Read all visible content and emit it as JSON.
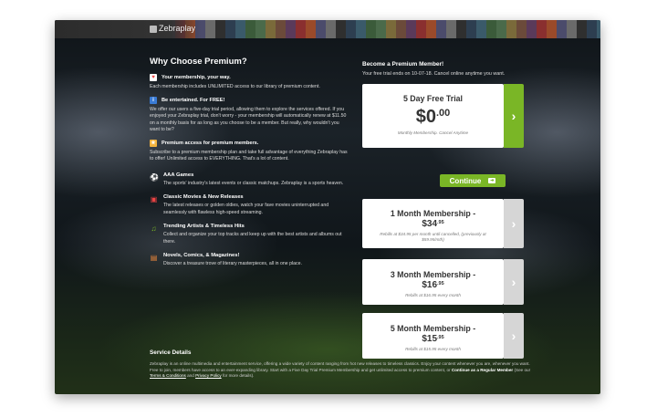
{
  "app": {
    "logo_text": "Zebraplay"
  },
  "colors": {
    "accent_green": "#7ab626",
    "card_bg": "#ffffff",
    "muted_arrow": "#d6d6d6"
  },
  "left": {
    "title": "Why Choose Premium?",
    "features": [
      {
        "icon": "heart-icon",
        "heading": "Your membership, your way.",
        "text": "Each membership includes UNLIMITED access to our library of premium content."
      },
      {
        "icon": "info-icon",
        "heading": "Be entertained. For FREE!",
        "text": "We offer our users a five-day trial period, allowing them to explore the services offered. If you enjoyed your Zebraplay trial, don't worry - your membership will automatically renew at $11.50 on a monthly basis for as long as you choose to be a member. But really, why wouldn't you want to be?"
      },
      {
        "icon": "star-icon",
        "heading": "Premium access for premium members.",
        "text": "Subscribe to a premium membership plan and take full advantage of everything Zebraplay has to offer! Unlimited access to EVERYTHING. That's a lot of content."
      }
    ],
    "items": [
      {
        "icon": "soccer-ball-icon",
        "title": "AAA Games",
        "text": "The sports' industry's latest events or classic matchups. Zebraplay is a sports heaven."
      },
      {
        "icon": "film-icon",
        "title": "Classic Movies & New Releases",
        "text": "The latest releases or golden oldies, watch your fave movies uninterrupted and seamlessly with flawless high-speed streaming."
      },
      {
        "icon": "headphones-icon",
        "title": "Trending Artists & Timeless Hits",
        "text": "Collect and organize your top tracks and keep up with the best artists and albums out there."
      },
      {
        "icon": "book-icon",
        "title": "Novels, Comics, & Magazines!",
        "text": "Discover a treasure trove of literary masterpieces, all in one place."
      }
    ]
  },
  "right": {
    "heading": "Become a Premium Member!",
    "subheading": "Your free trial ends on 10-07-18. Cancel online anytime you want.",
    "trial": {
      "title": "5 Day Free Trial",
      "price_main": "$0",
      "price_cents": ".00",
      "note": "Monthly Membership. Cancel Anytime"
    },
    "continue_label": "Continue",
    "plans": [
      {
        "title": "1 Month Membership -",
        "price_main": "$34",
        "price_cents": ".95",
        "note1": "Rebills at $34.95 per month until cancelled, (previously at",
        "note2": "$59.95/mth)"
      },
      {
        "title": "3 Month Membership -",
        "price_main": "$16",
        "price_cents": ".95",
        "note1": "Rebills at $16.95 every month",
        "note2": ""
      },
      {
        "title": "5 Month Membership -",
        "price_main": "$15",
        "price_cents": ".95",
        "note1": "Rebills at $15.95 every month",
        "note2": ""
      }
    ]
  },
  "service": {
    "heading": "Service Details",
    "text_part1": "Zebraplay is an online multimedia and entertainment service, offering a wide variety of content ranging from hot new releases to timeless classics. Enjoy your content whenever you are, whenever you want. Free to join, members have access to an ever-expanding library. Start with a Five Day Trial Premium Membership and get unlimited access to premium content, or",
    "bold_link": "Continue as a Regular Member",
    "text_part2": "(See our",
    "terms_link": "Terms & Conditions",
    "and_text": "and",
    "privacy_link": "Privacy Policy",
    "text_part3": "for more details)."
  }
}
